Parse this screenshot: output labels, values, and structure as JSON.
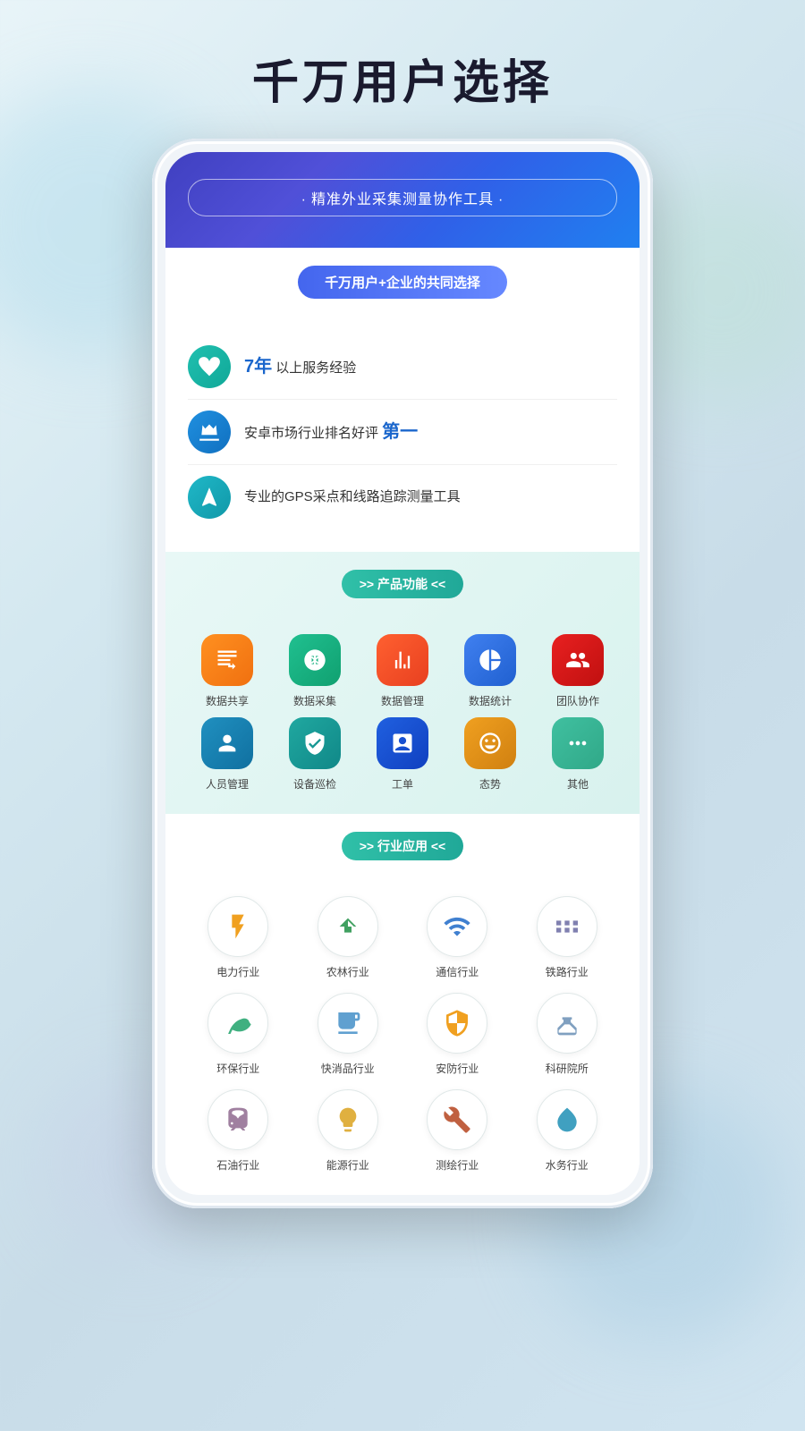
{
  "page": {
    "title": "千万用户选择",
    "background_colors": [
      "#e8f4f8",
      "#d4e8f0"
    ]
  },
  "banner": {
    "subtitle": "精准外业采集测量协作工具",
    "card_badge": "千万用户+企业的共同选择",
    "features": [
      {
        "icon_type": "teal",
        "text_prefix": "",
        "highlight": "7年",
        "text_suffix": " 以上服务经验"
      },
      {
        "icon_type": "blue",
        "text_prefix": "安卓市场行业排名好评 ",
        "highlight": "第一",
        "text_suffix": ""
      },
      {
        "icon_type": "cyan",
        "text_prefix": "专业的GPS采点和线路追踪测量工具",
        "highlight": "",
        "text_suffix": ""
      }
    ]
  },
  "product_section": {
    "badge": ">> 产品功能 <<",
    "items": [
      {
        "label": "数据共享",
        "color": "ic-orange"
      },
      {
        "label": "数据采集",
        "color": "ic-green"
      },
      {
        "label": "数据管理",
        "color": "ic-red-orange"
      },
      {
        "label": "数据统计",
        "color": "ic-blue"
      },
      {
        "label": "团队协作",
        "color": "ic-red"
      },
      {
        "label": "人员管理",
        "color": "ic-teal-blue"
      },
      {
        "label": "设备巡检",
        "color": "ic-teal-green"
      },
      {
        "label": "工单",
        "color": "ic-blue2"
      },
      {
        "label": "态势",
        "color": "ic-yellow"
      },
      {
        "label": "其他",
        "color": "ic-mint"
      }
    ]
  },
  "industry_section": {
    "badge": ">> 行业应用 <<",
    "rows": [
      [
        {
          "label": "电力行业",
          "icon": "⚡"
        },
        {
          "label": "农林行业",
          "icon": "🌲"
        },
        {
          "label": "通信行业",
          "icon": "📡"
        },
        {
          "label": "铁路行业",
          "icon": "🚆"
        }
      ],
      [
        {
          "label": "环保行业",
          "icon": "♻"
        },
        {
          "label": "快消品行业",
          "icon": "📦"
        },
        {
          "label": "安防行业",
          "icon": "🛡"
        },
        {
          "label": "科研院所",
          "icon": "🔬"
        }
      ],
      [
        {
          "label": "石油行业",
          "icon": "🔩"
        },
        {
          "label": "能源行业",
          "icon": "💡"
        },
        {
          "label": "测绘行业",
          "icon": "⚒"
        },
        {
          "label": "水务行业",
          "icon": "💧"
        }
      ]
    ]
  }
}
